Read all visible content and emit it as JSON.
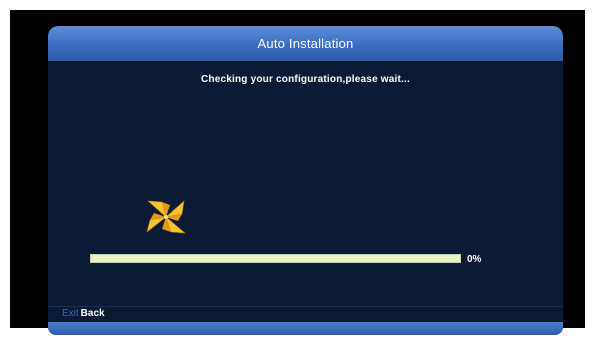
{
  "dialog": {
    "title": "Auto Installation",
    "status_message": "Checking your configuration,please wait...",
    "busy_icon": "pinwheel-icon"
  },
  "progress": {
    "value_percent": 0,
    "label": "0%"
  },
  "footer": {
    "key_label": "Exit",
    "action_label": "Back"
  },
  "colors": {
    "title_bar": "#3a6ec1",
    "panel_background": "#0c1a36",
    "progress_track": "#e9f3c6",
    "key_label": "#3d63c8",
    "pinwheel": "#f2b21c"
  }
}
